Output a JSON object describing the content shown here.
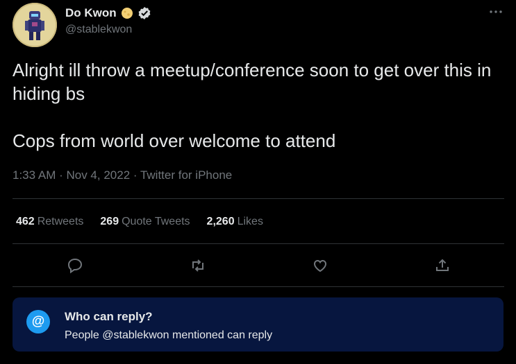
{
  "author": {
    "name": "Do Kwon",
    "handle": "@stablekwon"
  },
  "tweet": {
    "paragraphs": [
      "Alright ill throw a meetup/conference soon to get over this in hiding bs",
      "Cops from world over welcome to attend"
    ],
    "meta": "1:33 AM · Nov 4, 2022 · Twitter for iPhone"
  },
  "stats": {
    "retweets": {
      "count": "462",
      "label": "Retweets"
    },
    "quotes": {
      "count": "269",
      "label": "Quote Tweets"
    },
    "likes": {
      "count": "2,260",
      "label": "Likes"
    }
  },
  "actions": [
    "reply-icon",
    "retweet-icon",
    "like-icon",
    "share-icon"
  ],
  "reply_settings": {
    "icon_glyph": "@",
    "title": "Who can reply?",
    "description": "People @stablekwon mentioned can reply"
  },
  "colors": {
    "background": "#000000",
    "text": "#e7e9ea",
    "muted": "#71767b",
    "accent": "#1d9bf0",
    "reply_box": "#07163f"
  }
}
